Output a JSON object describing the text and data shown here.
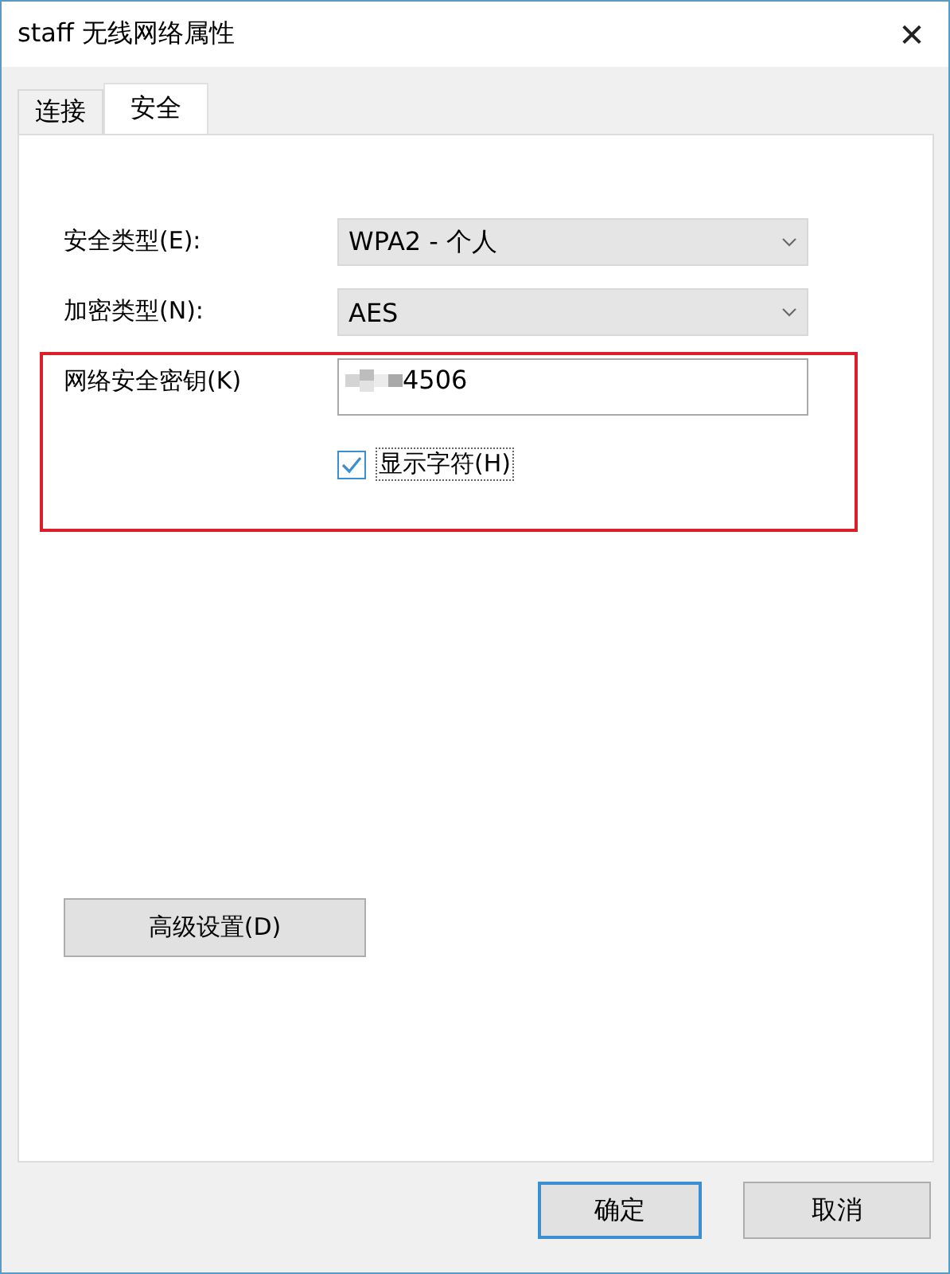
{
  "window": {
    "title": "staff 无线网络属性",
    "close_glyph": "✕"
  },
  "tabs": [
    {
      "label": "连接",
      "selected": false
    },
    {
      "label": "安全",
      "selected": true
    }
  ],
  "fields": [
    {
      "kind": "dropdown",
      "label": "安全类型(E):",
      "value": "WPA2 - 个人"
    },
    {
      "kind": "dropdown",
      "label": "加密类型(N):",
      "value": "AES"
    },
    {
      "kind": "text",
      "label": "网络安全密钥(K)",
      "value": "4506",
      "redacted": true
    }
  ],
  "show_characters": {
    "label": "显示字符(H)",
    "checked": true
  },
  "advanced_button": "高级设置(D)",
  "buttons": [
    {
      "label": "确定",
      "default": true
    },
    {
      "label": "取消",
      "default": false
    }
  ]
}
